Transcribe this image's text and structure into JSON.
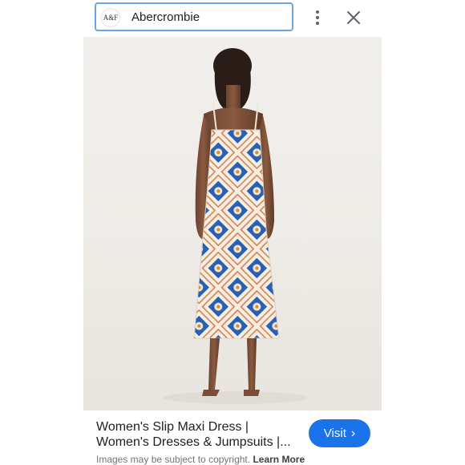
{
  "topbar": {
    "favicon_text": "A&F",
    "source_name": "Abercrombie",
    "more_icon": "more-vertical-icon",
    "close_icon": "close-icon"
  },
  "result": {
    "title_line1": "Women's Slip Maxi Dress |",
    "title_line2": "Women's Dresses & Jumpsuits |...",
    "visit_label": "Visit",
    "visit_icon": "chevron-right-icon",
    "copyright_text": "Images may be subject to copyright.",
    "learn_more": "Learn More"
  },
  "colors": {
    "accent": "#1a73e8",
    "chip_border": "#6aa6e6",
    "dress_blue": "#2b5fb0",
    "dress_orange": "#d87a3c"
  }
}
